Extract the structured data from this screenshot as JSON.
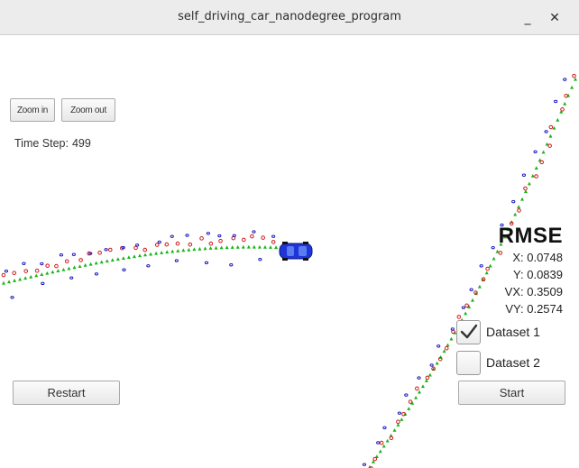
{
  "window": {
    "title": "self_driving_car_nanodegree_program",
    "minimize_glyph": "_",
    "close_glyph": "✕"
  },
  "controls": {
    "zoom_in_label": "Zoom in",
    "zoom_out_label": "Zoom out",
    "restart_label": "Restart",
    "start_label": "Start"
  },
  "status": {
    "time_step_label": "Time Step:",
    "time_step_value": "499"
  },
  "rmse": {
    "heading": "RMSE",
    "x": "X: 0.0748",
    "y": "Y: 0.0839",
    "vx": "VX: 0.3509",
    "vy": "VY: 0.2574"
  },
  "datasets": [
    {
      "label": "Dataset 1",
      "checked": true
    },
    {
      "label": "Dataset 2",
      "checked": false
    }
  ],
  "colors": {
    "estimate_marker": "#18b418",
    "lidar_marker": "#d01818",
    "radar_marker": "#1818c0",
    "car_body": "#1f35d8"
  }
}
